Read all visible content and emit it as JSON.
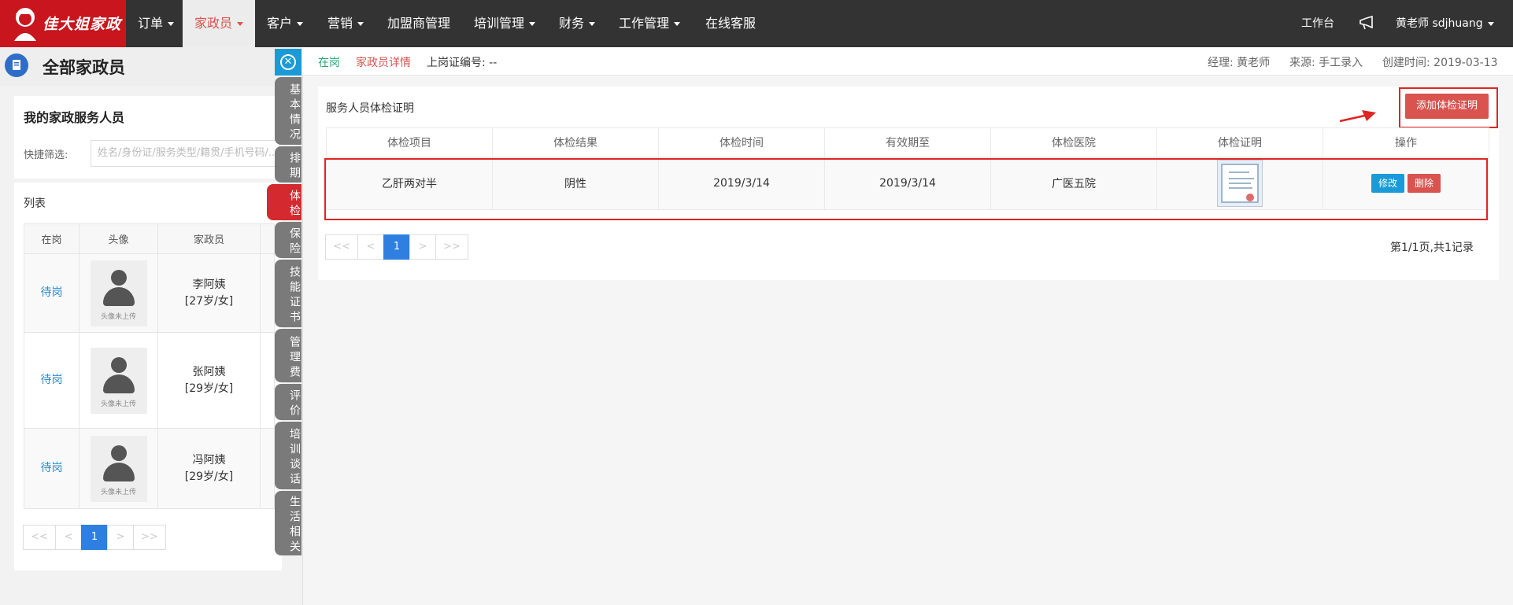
{
  "nav": {
    "logo": "佳大姐家政",
    "items": [
      {
        "label": "订单",
        "dropdown": true
      },
      {
        "label": "家政员",
        "dropdown": true,
        "active": true
      },
      {
        "label": "客户",
        "dropdown": true
      },
      {
        "label": "营销",
        "dropdown": true
      },
      {
        "label": "加盟商管理",
        "dropdown": false
      },
      {
        "label": "培训管理",
        "dropdown": true
      },
      {
        "label": "财务",
        "dropdown": true
      },
      {
        "label": "工作管理",
        "dropdown": true
      },
      {
        "label": "在线客服",
        "dropdown": false
      }
    ],
    "workbench": "工作台",
    "user": "黄老师 sdjhuang"
  },
  "left": {
    "title": "全部家政员",
    "my_staff": "我的家政服务人员",
    "filter_label": "快捷筛选:",
    "filter_placeholder": "姓名/身份证/服务类型/籍贯/手机号码/...",
    "list_label": "列表",
    "headers": [
      "在岗",
      "头像",
      "家政员"
    ],
    "avatar_caption": "头像未上传",
    "rows": [
      {
        "status": "待岗",
        "name": "李阿姨",
        "info": "[27岁/女]"
      },
      {
        "status": "待岗",
        "name": "张阿姨",
        "info": "[29岁/女]"
      },
      {
        "status": "待岗",
        "name": "冯阿姨",
        "info": "[29岁/女]"
      }
    ],
    "pager": {
      "first": "<<",
      "prev": "<",
      "current": "1",
      "next": ">",
      "last": ">>"
    }
  },
  "side_tabs": [
    {
      "label": "基本情况",
      "active": false
    },
    {
      "label": "排期",
      "active": false
    },
    {
      "label": "体检",
      "active": true
    },
    {
      "label": "保险",
      "active": false
    },
    {
      "label": "技能证书",
      "active": false
    },
    {
      "label": "管理费",
      "active": false
    },
    {
      "label": "评价",
      "active": false
    },
    {
      "label": "培训谈话",
      "active": false
    },
    {
      "label": "生活相关",
      "active": false
    }
  ],
  "info_bar": {
    "status": "在岗",
    "detail_link": "家政员详情",
    "cert_no": "上岗证编号: --",
    "manager": "经理: 黄老师",
    "source": "来源: 手工录入",
    "created": "创建时间: 2019-03-13"
  },
  "colors": {
    "status": "#2aa876",
    "detail": "#d9534f",
    "meta": "#666666"
  },
  "exam": {
    "title": "服务人员体检证明",
    "add_button": "添加体检证明",
    "headers": [
      "体检项目",
      "体检结果",
      "体检时间",
      "有效期至",
      "体检医院",
      "体检证明",
      "操作"
    ],
    "rows": [
      {
        "item": "乙肝两对半",
        "result": "阴性",
        "date": "2019/3/14",
        "valid_until": "2019/3/14",
        "hospital": "广医五院"
      }
    ],
    "edit_label": "修改",
    "delete_label": "删除",
    "pager": {
      "first": "<<",
      "prev": "<",
      "current": "1",
      "next": ">",
      "last": ">>"
    },
    "page_info": "第1/1页,共1记录"
  }
}
